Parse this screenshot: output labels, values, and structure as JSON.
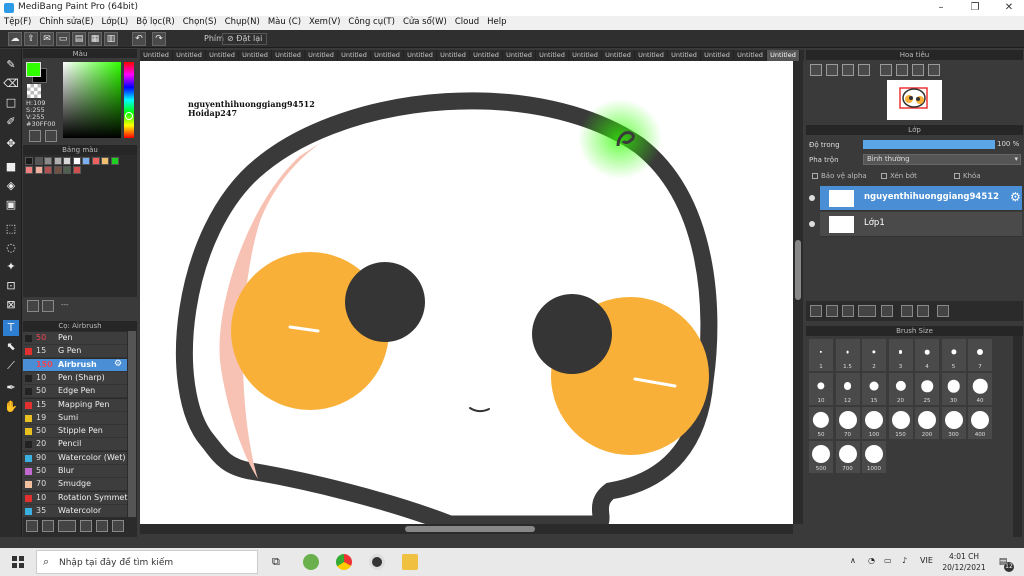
{
  "window": {
    "title": "MediBang Paint Pro (64bit)"
  },
  "menu": [
    "Tệp(F)",
    "Chỉnh sửa(E)",
    "Lớp(L)",
    "Bộ lọc(R)",
    "Chọn(S)",
    "Chụp(N)",
    "Màu (C)",
    "Xem(V)",
    "Công cụ(T)",
    "Cửa sổ(W)",
    "Cloud",
    "Help"
  ],
  "toolbar": {
    "shortcut_label": "Phím",
    "reset_label": "Đặt lại"
  },
  "color_panel": {
    "title": "Màu",
    "primary_color": "#30FF00",
    "readout": [
      "H:109",
      "S:255",
      "V:255",
      "#30FF00"
    ]
  },
  "palette_panel": {
    "title": "Bảng màu",
    "colors": [
      "#1a1a1a",
      "#555555",
      "#8a8a8a",
      "#b0b0b0",
      "#d8d8d8",
      "#ffffff",
      "#7ab0f0",
      "#f06060",
      "#f0c070",
      "#20d020",
      "#f08080",
      "#f0b0a0",
      "#b05050",
      "#705040",
      "#506050",
      "#d05050"
    ],
    "footer": "---"
  },
  "brush_panel": {
    "title": "Cọ: Airbrush",
    "brushes": [
      {
        "size": "50",
        "name": "Pen",
        "color": "#222222",
        "red": true
      },
      {
        "size": "15",
        "name": "G Pen",
        "color": "#e03030",
        "red": false
      },
      {
        "size": "150",
        "name": "Airbrush",
        "color": "#4a8fd6",
        "red": true,
        "selected": true
      },
      {
        "size": "10",
        "name": "Pen (Sharp)",
        "color": "#222222",
        "red": false
      },
      {
        "size": "50",
        "name": "Edge Pen",
        "color": "#222222",
        "red": false
      },
      {
        "size": "15",
        "name": "Mapping Pen",
        "color": "#e03030",
        "red": false
      },
      {
        "size": "19",
        "name": "Sumi",
        "color": "#e8c020",
        "red": false
      },
      {
        "size": "50",
        "name": "Stipple Pen",
        "color": "#e8c020",
        "red": false
      },
      {
        "size": "20",
        "name": "Pencil",
        "color": "#222222",
        "red": false
      },
      {
        "size": "90",
        "name": "Watercolor (Wet)",
        "color": "#3ab0e0",
        "red": false
      },
      {
        "size": "50",
        "name": "Blur",
        "color": "#c06ad0",
        "red": false
      },
      {
        "size": "70",
        "name": "Smudge",
        "color": "#f0c0a0",
        "red": false
      },
      {
        "size": "10",
        "name": "Rotation Symmetry",
        "color": "#e03030",
        "red": false
      },
      {
        "size": "35",
        "name": "Watercolor",
        "color": "#3ab0e0",
        "red": false
      }
    ]
  },
  "tabs": [
    "Untitled",
    "Untitled",
    "Untitled",
    "Untitled",
    "Untitled",
    "Untitled",
    "Untitled",
    "Untitled",
    "Untitled",
    "Untitled",
    "Untitled",
    "Untitled",
    "Untitled",
    "Untitled",
    "Untitled",
    "Untitled",
    "Untitled",
    "Untitled",
    "Untitled",
    "Untitled"
  ],
  "canvas": {
    "watermark_lines": [
      "nguyenthihuonggiang94512",
      "Hoidap247"
    ]
  },
  "navigator": {
    "title": "Hoa tiêu"
  },
  "layer_panel": {
    "title": "Lớp",
    "opacity_label": "Độ trong",
    "opacity_value": "100 %",
    "opacity": 1.0,
    "blend_label": "Pha trộn",
    "blend_value": "Bình thường",
    "checkbox_alpha": "Bảo vệ alpha",
    "checkbox_clip": "Xén bớt",
    "checkbox_lock": "Khóa",
    "layers": [
      {
        "name": "nguyenthihuonggiang94512",
        "selected": true
      },
      {
        "name": "Lớp1",
        "selected": false
      }
    ]
  },
  "brush_size_panel": {
    "title": "Brush Size",
    "sizes": [
      "1",
      "1.5",
      "2",
      "3",
      "4",
      "5",
      "7",
      "10",
      "12",
      "15",
      "20",
      "25",
      "30",
      "40",
      "50",
      "70",
      "100",
      "150",
      "200",
      "300",
      "400",
      "500",
      "700",
      "1000"
    ]
  },
  "taskbar": {
    "search_placeholder": "Nhập tại đây để tìm kiếm",
    "language": "VIE",
    "time": "4:01 CH",
    "date": "20/12/2021",
    "notification_count": "12"
  }
}
